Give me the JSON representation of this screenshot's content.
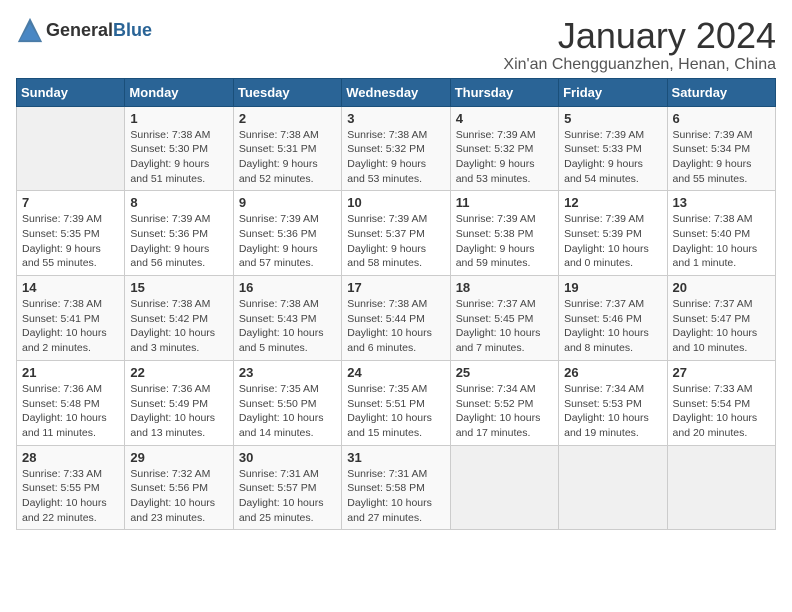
{
  "logo": {
    "general": "General",
    "blue": "Blue"
  },
  "title": "January 2024",
  "subtitle": "Xin'an Chengguanzhen, Henan, China",
  "days_of_week": [
    "Sunday",
    "Monday",
    "Tuesday",
    "Wednesday",
    "Thursday",
    "Friday",
    "Saturday"
  ],
  "weeks": [
    [
      {
        "day": "",
        "info": ""
      },
      {
        "day": "1",
        "info": "Sunrise: 7:38 AM\nSunset: 5:30 PM\nDaylight: 9 hours\nand 51 minutes."
      },
      {
        "day": "2",
        "info": "Sunrise: 7:38 AM\nSunset: 5:31 PM\nDaylight: 9 hours\nand 52 minutes."
      },
      {
        "day": "3",
        "info": "Sunrise: 7:38 AM\nSunset: 5:32 PM\nDaylight: 9 hours\nand 53 minutes."
      },
      {
        "day": "4",
        "info": "Sunrise: 7:39 AM\nSunset: 5:32 PM\nDaylight: 9 hours\nand 53 minutes."
      },
      {
        "day": "5",
        "info": "Sunrise: 7:39 AM\nSunset: 5:33 PM\nDaylight: 9 hours\nand 54 minutes."
      },
      {
        "day": "6",
        "info": "Sunrise: 7:39 AM\nSunset: 5:34 PM\nDaylight: 9 hours\nand 55 minutes."
      }
    ],
    [
      {
        "day": "7",
        "info": "Sunrise: 7:39 AM\nSunset: 5:35 PM\nDaylight: 9 hours\nand 55 minutes."
      },
      {
        "day": "8",
        "info": "Sunrise: 7:39 AM\nSunset: 5:36 PM\nDaylight: 9 hours\nand 56 minutes."
      },
      {
        "day": "9",
        "info": "Sunrise: 7:39 AM\nSunset: 5:36 PM\nDaylight: 9 hours\nand 57 minutes."
      },
      {
        "day": "10",
        "info": "Sunrise: 7:39 AM\nSunset: 5:37 PM\nDaylight: 9 hours\nand 58 minutes."
      },
      {
        "day": "11",
        "info": "Sunrise: 7:39 AM\nSunset: 5:38 PM\nDaylight: 9 hours\nand 59 minutes."
      },
      {
        "day": "12",
        "info": "Sunrise: 7:39 AM\nSunset: 5:39 PM\nDaylight: 10 hours\nand 0 minutes."
      },
      {
        "day": "13",
        "info": "Sunrise: 7:38 AM\nSunset: 5:40 PM\nDaylight: 10 hours\nand 1 minute."
      }
    ],
    [
      {
        "day": "14",
        "info": "Sunrise: 7:38 AM\nSunset: 5:41 PM\nDaylight: 10 hours\nand 2 minutes."
      },
      {
        "day": "15",
        "info": "Sunrise: 7:38 AM\nSunset: 5:42 PM\nDaylight: 10 hours\nand 3 minutes."
      },
      {
        "day": "16",
        "info": "Sunrise: 7:38 AM\nSunset: 5:43 PM\nDaylight: 10 hours\nand 5 minutes."
      },
      {
        "day": "17",
        "info": "Sunrise: 7:38 AM\nSunset: 5:44 PM\nDaylight: 10 hours\nand 6 minutes."
      },
      {
        "day": "18",
        "info": "Sunrise: 7:37 AM\nSunset: 5:45 PM\nDaylight: 10 hours\nand 7 minutes."
      },
      {
        "day": "19",
        "info": "Sunrise: 7:37 AM\nSunset: 5:46 PM\nDaylight: 10 hours\nand 8 minutes."
      },
      {
        "day": "20",
        "info": "Sunrise: 7:37 AM\nSunset: 5:47 PM\nDaylight: 10 hours\nand 10 minutes."
      }
    ],
    [
      {
        "day": "21",
        "info": "Sunrise: 7:36 AM\nSunset: 5:48 PM\nDaylight: 10 hours\nand 11 minutes."
      },
      {
        "day": "22",
        "info": "Sunrise: 7:36 AM\nSunset: 5:49 PM\nDaylight: 10 hours\nand 13 minutes."
      },
      {
        "day": "23",
        "info": "Sunrise: 7:35 AM\nSunset: 5:50 PM\nDaylight: 10 hours\nand 14 minutes."
      },
      {
        "day": "24",
        "info": "Sunrise: 7:35 AM\nSunset: 5:51 PM\nDaylight: 10 hours\nand 15 minutes."
      },
      {
        "day": "25",
        "info": "Sunrise: 7:34 AM\nSunset: 5:52 PM\nDaylight: 10 hours\nand 17 minutes."
      },
      {
        "day": "26",
        "info": "Sunrise: 7:34 AM\nSunset: 5:53 PM\nDaylight: 10 hours\nand 19 minutes."
      },
      {
        "day": "27",
        "info": "Sunrise: 7:33 AM\nSunset: 5:54 PM\nDaylight: 10 hours\nand 20 minutes."
      }
    ],
    [
      {
        "day": "28",
        "info": "Sunrise: 7:33 AM\nSunset: 5:55 PM\nDaylight: 10 hours\nand 22 minutes."
      },
      {
        "day": "29",
        "info": "Sunrise: 7:32 AM\nSunset: 5:56 PM\nDaylight: 10 hours\nand 23 minutes."
      },
      {
        "day": "30",
        "info": "Sunrise: 7:31 AM\nSunset: 5:57 PM\nDaylight: 10 hours\nand 25 minutes."
      },
      {
        "day": "31",
        "info": "Sunrise: 7:31 AM\nSunset: 5:58 PM\nDaylight: 10 hours\nand 27 minutes."
      },
      {
        "day": "",
        "info": ""
      },
      {
        "day": "",
        "info": ""
      },
      {
        "day": "",
        "info": ""
      }
    ]
  ]
}
